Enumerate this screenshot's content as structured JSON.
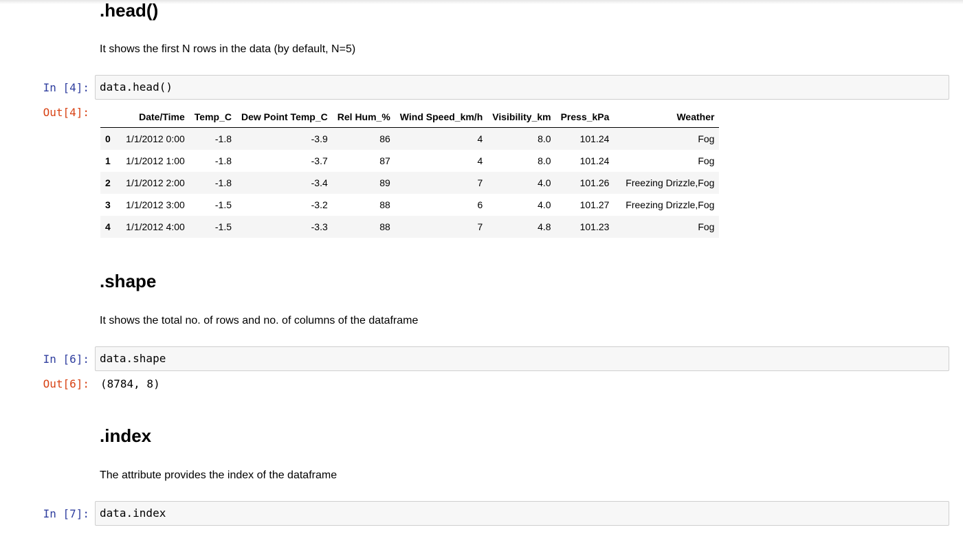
{
  "sections": {
    "head": {
      "title": ".head()",
      "description": "It shows the first N rows in the data (by default, N=5)"
    },
    "shape": {
      "title": ".shape",
      "description": "It shows the total no. of rows and no. of columns of the dataframe"
    },
    "index": {
      "title": ".index",
      "description": "The attribute provides the index of the dataframe"
    }
  },
  "cells": {
    "c4": {
      "in_prompt": "In [4]:",
      "code": "data.head()",
      "out_prompt": "Out[4]:"
    },
    "c6": {
      "in_prompt": "In [6]:",
      "code": "data.shape",
      "out_prompt": "Out[6]:",
      "output": "(8784, 8)"
    },
    "c7": {
      "in_prompt": "In [7]:",
      "code": "data.index"
    }
  },
  "dataframe": {
    "columns": [
      "",
      "Date/Time",
      "Temp_C",
      "Dew Point Temp_C",
      "Rel Hum_%",
      "Wind Speed_km/h",
      "Visibility_km",
      "Press_kPa",
      "Weather"
    ],
    "rows": [
      [
        "0",
        "1/1/2012 0:00",
        "-1.8",
        "-3.9",
        "86",
        "4",
        "8.0",
        "101.24",
        "Fog"
      ],
      [
        "1",
        "1/1/2012 1:00",
        "-1.8",
        "-3.7",
        "87",
        "4",
        "8.0",
        "101.24",
        "Fog"
      ],
      [
        "2",
        "1/1/2012 2:00",
        "-1.8",
        "-3.4",
        "89",
        "7",
        "4.0",
        "101.26",
        "Freezing Drizzle,Fog"
      ],
      [
        "3",
        "1/1/2012 3:00",
        "-1.5",
        "-3.2",
        "88",
        "6",
        "4.0",
        "101.27",
        "Freezing Drizzle,Fog"
      ],
      [
        "4",
        "1/1/2012 4:00",
        "-1.5",
        "-3.3",
        "88",
        "7",
        "4.8",
        "101.23",
        "Fog"
      ]
    ]
  },
  "colors": {
    "in_prompt": "#303f9f",
    "out_prompt": "#d84315",
    "input_bg": "#f7f7f7",
    "input_border": "#cfcfcf"
  }
}
